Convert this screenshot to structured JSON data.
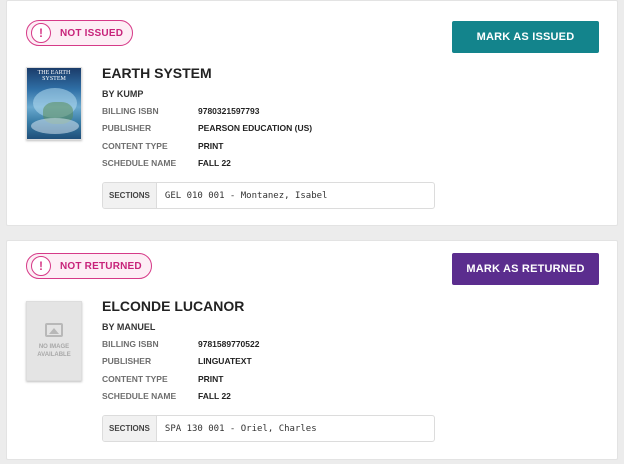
{
  "orders": [
    {
      "status": "NOT ISSUED",
      "status_icon": "!",
      "action_label": "MARK AS ISSUED",
      "action_color": "#13848c",
      "cover_title": "THE EARTH SYSTEM",
      "title": "EARTH SYSTEM",
      "author": "BY KUMP",
      "billing_isbn_label": "BILLING ISBN",
      "billing_isbn": "9780321597793",
      "publisher_label": "PUBLISHER",
      "publisher": "PEARSON EDUCATION (US)",
      "content_type_label": "CONTENT TYPE",
      "content_type": "PRINT",
      "schedule_name_label": "SCHEDULE NAME",
      "schedule_name": "FALL 22",
      "sections_label": "SECTIONS",
      "sections": "GEL 010 001 - Montanez, Isabel"
    },
    {
      "status": "NOT RETURNED",
      "status_icon": "!",
      "action_label": "MARK AS RETURNED",
      "action_color": "#5b2d8e",
      "no_image_text": "NO IMAGE AVAILABLE",
      "title": "ELCONDE LUCANOR",
      "author": "BY MANUEL",
      "billing_isbn_label": "BILLING ISBN",
      "billing_isbn": "9781589770522",
      "publisher_label": "PUBLISHER",
      "publisher": "LINGUATEXT",
      "content_type_label": "CONTENT TYPE",
      "content_type": "PRINT",
      "schedule_name_label": "SCHEDULE NAME",
      "schedule_name": "FALL 22",
      "sections_label": "SECTIONS",
      "sections": "SPA 130 001 - Oriel, Charles"
    }
  ],
  "colors": {
    "badge_accent": "#d63a88",
    "badge_bg": "#fdeef5"
  }
}
